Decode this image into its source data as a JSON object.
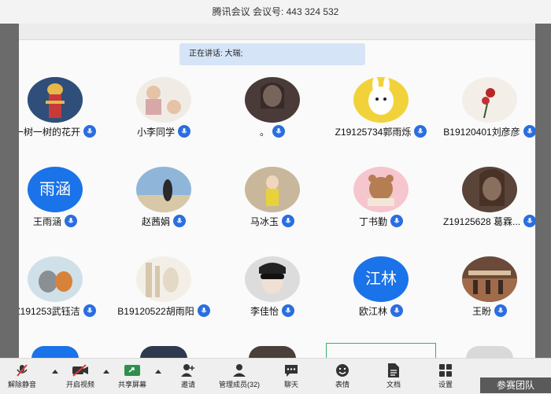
{
  "window": {
    "title": "腾讯会议 会议号: 443 324 532"
  },
  "speaking": {
    "text": "正在讲话: 大瑞;"
  },
  "participants": [
    {
      "name": "一树一树的花开",
      "avatar": "photo"
    },
    {
      "name": "小李同学",
      "avatar": "photo"
    },
    {
      "name": "。",
      "avatar": "photo"
    },
    {
      "name": "Z19125734郭雨烁",
      "avatar": "photo"
    },
    {
      "name": "B19120401刘彦彦",
      "avatar": "photo"
    },
    {
      "name": "王雨涵",
      "avatar": "text",
      "avatar_text": "雨涵"
    },
    {
      "name": "赵茜娟",
      "avatar": "photo"
    },
    {
      "name": "马冰玉",
      "avatar": "photo"
    },
    {
      "name": "丁书勤",
      "avatar": "photo"
    },
    {
      "name": "Z19125628 葛霖...",
      "avatar": "photo"
    },
    {
      "name": "Z191253武钰洁",
      "avatar": "photo"
    },
    {
      "name": "B19120522胡雨阳",
      "avatar": "photo"
    },
    {
      "name": "李佳怡",
      "avatar": "photo"
    },
    {
      "name": "欧江林",
      "avatar": "text",
      "avatar_text": "江林"
    },
    {
      "name": "王盼",
      "avatar": "photo"
    }
  ],
  "toolbar": {
    "unmute": "解除静音",
    "start_video": "开启视频",
    "share_screen": "共享屏幕",
    "invite": "邀请",
    "manage_members": "管理成员(32)",
    "chat": "聊天",
    "reactions": "表情",
    "documents": "文档",
    "settings": "设置"
  },
  "participants_panel": {
    "label": "参赛团队"
  },
  "colors": {
    "accent": "#2a6ee0",
    "muted_red": "#e03b3b",
    "active_speaker": "#33b36b"
  }
}
